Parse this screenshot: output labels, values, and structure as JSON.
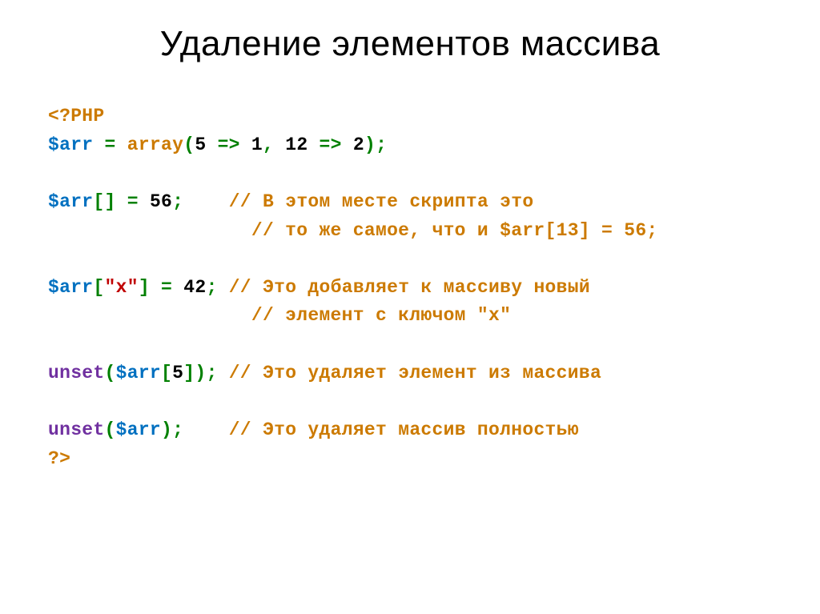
{
  "title": "Удаление элементов массива",
  "code": {
    "php_open": "<?PHP",
    "line2": {
      "var": "$arr",
      "eq": " = ",
      "func": "array",
      "lparen": "(",
      "k1": "5",
      "arrow1": " => ",
      "v1": "1",
      "comma": ", ",
      "k2": "12",
      "arrow2": " => ",
      "v2": "2",
      "rparen": ")",
      "semi": ";"
    },
    "line3": {
      "var": "$arr",
      "brackets": "[]",
      "eq": " = ",
      "val": "56",
      "semi": ";",
      "pad": "    ",
      "c1": "// В этом месте скрипта это",
      "c2": "// то же самое, что и $arr[13] = 56;"
    },
    "line4": {
      "var": "$arr",
      "lb": "[",
      "key": "\"x\"",
      "rb": "]",
      "eq": " = ",
      "val": "42",
      "semi": ";",
      "c1": " // Это добавляет к массиву новый",
      "c2": "// элемент с ключом \"x\""
    },
    "line5": {
      "func": "unset",
      "lparen": "(",
      "var": "$arr",
      "lb": "[",
      "idx": "5",
      "rb": "]",
      "rparen": ")",
      "semi": ";",
      "c1": " // Это удаляет элемент из массива"
    },
    "line6": {
      "func": "unset",
      "lparen": "(",
      "var": "$arr",
      "rparen": ")",
      "semi": ";",
      "pad": "    ",
      "c1": "// Это удаляет массив полностью"
    },
    "php_close": "?>"
  }
}
